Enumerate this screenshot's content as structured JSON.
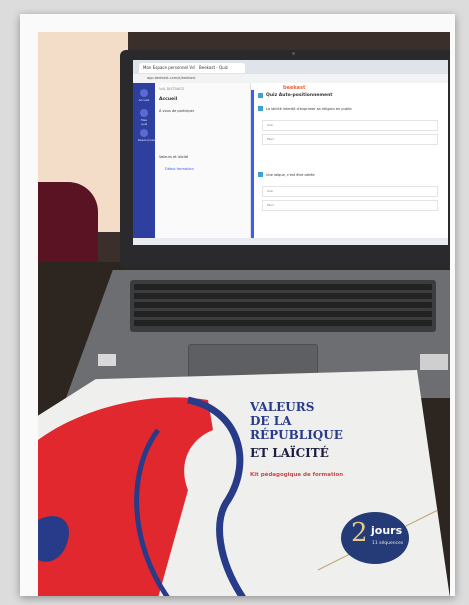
{
  "screen": {
    "tabs": [
      "Mon Espace personnel VdR",
      "Beekast - Quiz"
    ],
    "url": "app.beekast.com/a/beekast",
    "logo": "beekast",
    "sidebar_items": [
      "Accueil",
      "Mes quiz",
      "Ressources"
    ],
    "left_panel": {
      "header": "VdL DISTANCE",
      "title": "Accueil",
      "intro": "À vous de participer",
      "session": "Valeurs et laïcité",
      "item": "Début formation"
    },
    "quiz": {
      "title": "Quiz Auto-positionnement",
      "question1": "La laïcité interdit d'exprimer sa religion en public",
      "answers1": [
        "Vrai",
        "Faux"
      ],
      "question2": "Une laïque, c'est être athée",
      "answers2": [
        "Vrai",
        "Faux"
      ]
    }
  },
  "booklet": {
    "title_lines": "VALEURS\nDE LA\nRÉPUBLIQUE",
    "title_last": "ET LAÏCITÉ",
    "subtitle": "Kit pédagogique de formation",
    "badge_number": "2",
    "badge_unit": "jours",
    "badge_detail": "11 séquences"
  },
  "colors": {
    "booklet_blue": "#283b88",
    "booklet_red": "#e0282e",
    "badge_gold": "#e7c986",
    "beekast_orange": "#f2633a"
  }
}
